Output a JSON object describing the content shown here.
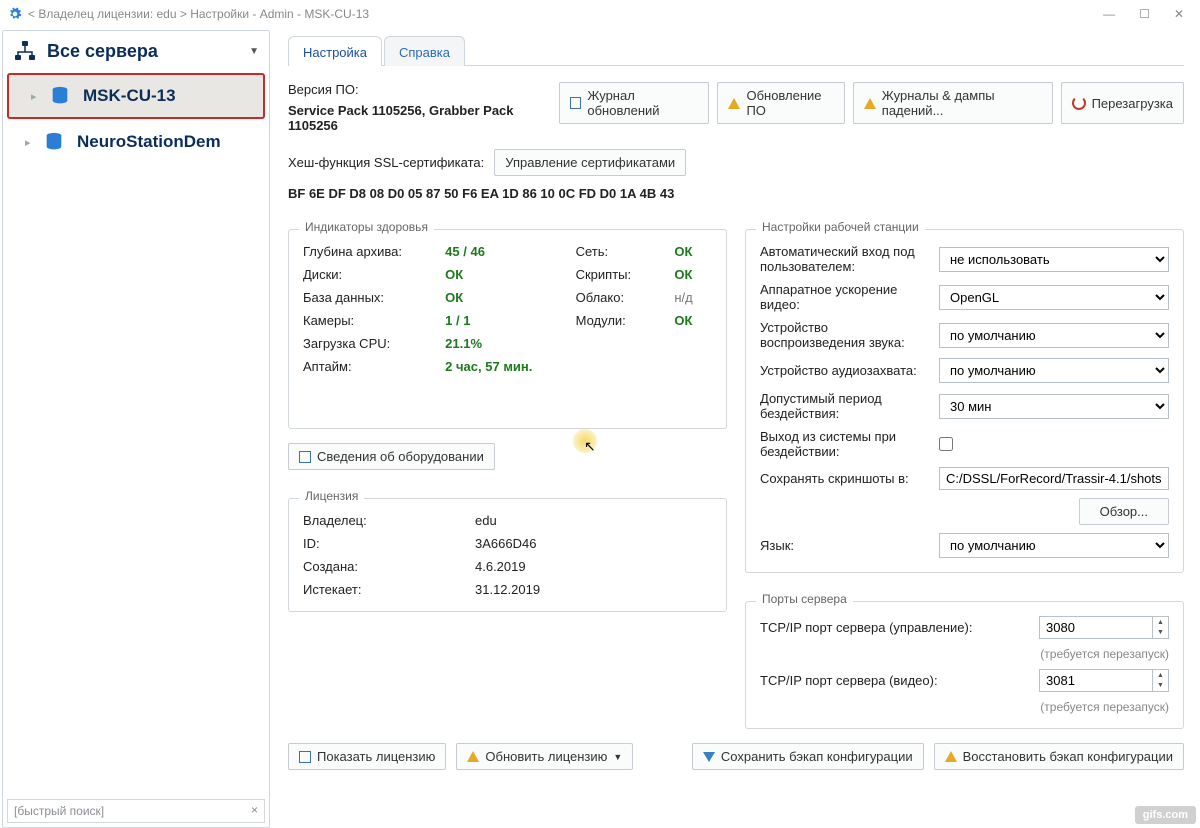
{
  "titlebar": {
    "path": "< Владелец лицензии: edu > Настройки - Admin - MSK-CU-13"
  },
  "sidebar": {
    "heading": "Все сервера",
    "servers": [
      {
        "name": "MSK-CU-13"
      },
      {
        "name": "NeuroStationDem"
      }
    ],
    "search_placeholder": "[быстрый поиск]"
  },
  "tabs": {
    "settings": "Настройка",
    "help": "Справка"
  },
  "version": {
    "label": "Версия ПО:",
    "value": "Service Pack 1105256, Grabber Pack 1105256"
  },
  "top_buttons": {
    "journal": "Журнал обновлений",
    "update": "Обновление ПО",
    "logs": "Журналы & дампы падений...",
    "reboot": "Перезагрузка"
  },
  "ssl": {
    "label": "Хеш-функция SSL-cертификата:",
    "manage": "Управление сертификатами",
    "hash": "BF 6E DF D8 08 D0 05 87 50 F6 EA 1D 86 10 0C FD D0 1A 4B 43"
  },
  "health": {
    "legend": "Индикаторы здоровья",
    "archive_k": "Глубина архива:",
    "archive_v": "45 / 46",
    "disks_k": "Диски:",
    "disks_v": "ОК",
    "db_k": "База данных:",
    "db_v": "ОК",
    "cams_k": "Камеры:",
    "cams_v": "1 / 1",
    "cpu_k": "Загрузка CPU:",
    "cpu_v": "21.1%",
    "uptime_k": "Аптайм:",
    "uptime_v": "2 час, 57 мин.",
    "net_k": "Сеть:",
    "net_v": "ОК",
    "scripts_k": "Скрипты:",
    "scripts_v": "ОК",
    "cloud_k": "Облако:",
    "cloud_v": "н/д",
    "modules_k": "Модули:",
    "modules_v": "ОК"
  },
  "hw_info_btn": "Сведения об оборудовании",
  "ws": {
    "legend": "Настройки рабочей станции",
    "auto_login_k": "Автоматический вход под пользователем:",
    "auto_login_v": "не использовать",
    "hw_accel_k": "Аппаратное ускорение видео:",
    "hw_accel_v": "OpenGL",
    "audio_out_k": "Устройство воспроизведения звука:",
    "audio_out_v": "по умолчанию",
    "audio_in_k": "Устройство аудиозахвата:",
    "audio_in_v": "по умолчанию",
    "idle_k": "Допустимый период бездействия:",
    "idle_v": "30 мин",
    "logout_idle_k": "Выход из системы при бездействии:",
    "shots_k": "Сохранять скриншоты в:",
    "shots_v": "C:/DSSL/ForRecord/Trassir-4.1/shots",
    "browse": "Обзор...",
    "lang_k": "Язык:",
    "lang_v": "по умолчанию"
  },
  "license": {
    "legend": "Лицензия",
    "owner_k": "Владелец:",
    "owner_v": "edu",
    "id_k": "ID:",
    "id_v": "3A666D46",
    "created_k": "Создана:",
    "created_v": "4.6.2019",
    "expires_k": "Истекает:",
    "expires_v": "31.12.2019"
  },
  "ports": {
    "legend": "Порты сервера",
    "mgmt_k": "TCP/IP порт сервера (управление):",
    "mgmt_v": "3080",
    "video_k": "TCP/IP порт сервера (видео):",
    "video_v": "3081",
    "restart_hint": "(требуется перезапуск)"
  },
  "bottom": {
    "show_license": "Показать лицензию",
    "update_license": "Обновить лицензию",
    "save_backup": "Сохранить бэкап конфигурации",
    "restore_backup": "Восстановить бэкап конфигурации"
  },
  "watermark": "gifs.com"
}
